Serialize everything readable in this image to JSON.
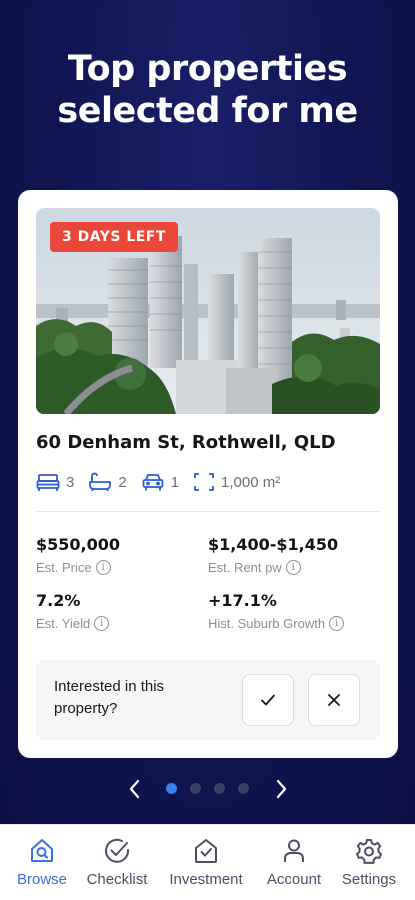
{
  "headline": "Top properties\nselected for me",
  "card": {
    "badge": "3 DAYS LEFT",
    "address": "60 Denham St, Rothwell, QLD",
    "features": {
      "bedrooms": "3",
      "bathrooms": "2",
      "car_spaces": "1",
      "land_size": "1,000 m²"
    },
    "stats": [
      {
        "value": "$550,000",
        "label": "Est. Price"
      },
      {
        "value": "$1,400-$1,450",
        "label": "Est. Rent pw"
      },
      {
        "value": "7.2%",
        "label": "Est. Yield"
      },
      {
        "value": "+17.1%",
        "label": "Hist. Suburb Growth"
      }
    ],
    "interest_prompt": "Interested in this\nproperty?"
  },
  "pager": {
    "total": 4,
    "active_index": 0
  },
  "tabs": [
    {
      "label": "Browse",
      "icon": "home-search-icon",
      "active": true
    },
    {
      "label": "Checklist",
      "icon": "check-circle-icon",
      "active": false
    },
    {
      "label": "Investment",
      "icon": "house-check-icon",
      "active": false
    },
    {
      "label": "Account",
      "icon": "person-icon",
      "active": false
    },
    {
      "label": "Settings",
      "icon": "gear-icon",
      "active": false
    }
  ],
  "colors": {
    "background": "#0f1450",
    "accent": "#3b6fe0",
    "badge": "#e9473a",
    "pager_active": "#3a82ea"
  }
}
